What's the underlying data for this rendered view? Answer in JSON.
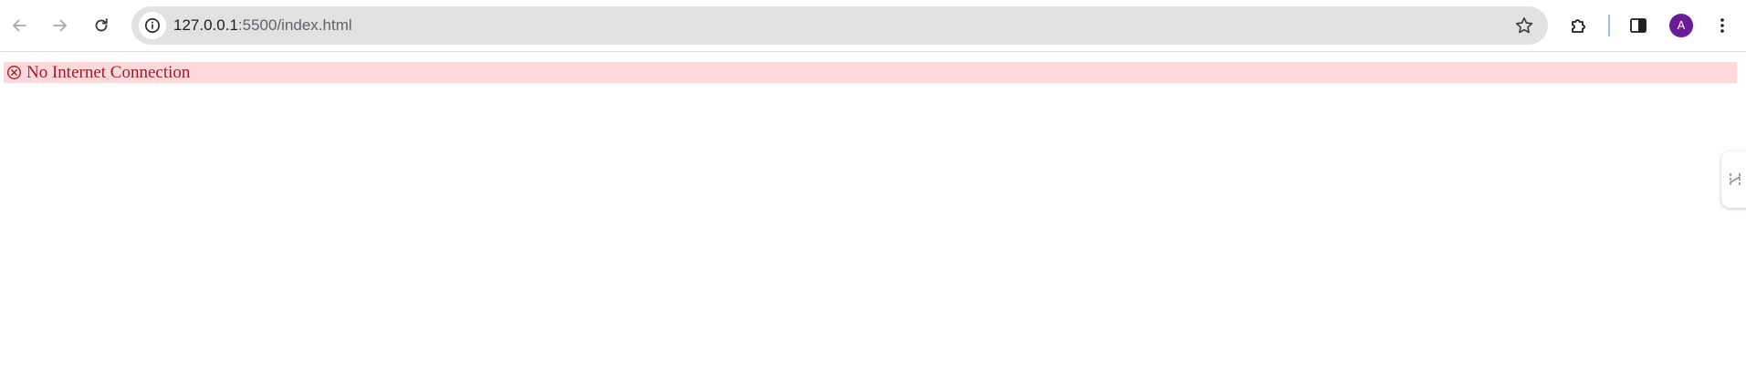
{
  "browser": {
    "url_host": "127.0.0.1",
    "url_rest": ":5500/index.html",
    "profile_initial": "A",
    "colors": {
      "avatar": "#6a1b9a",
      "omnibox": "#e2e2e2",
      "toolbar_separator": "#8ec7f1"
    },
    "icons": {
      "back": "arrow-back-icon",
      "forward": "arrow-forward-icon",
      "reload": "reload-icon",
      "site_info": "info-icon",
      "bookmark": "star-icon",
      "extensions": "puzzle-icon",
      "side_panel": "side-panel-icon",
      "menu": "kebab-menu-icon"
    }
  },
  "page": {
    "error_message": "No Internet Connection",
    "error_icon": "circle-x-icon",
    "colors": {
      "error_background": "#fdd9dc",
      "error_text": "#a11c2b"
    },
    "side_tab_icon": "link-icon"
  }
}
